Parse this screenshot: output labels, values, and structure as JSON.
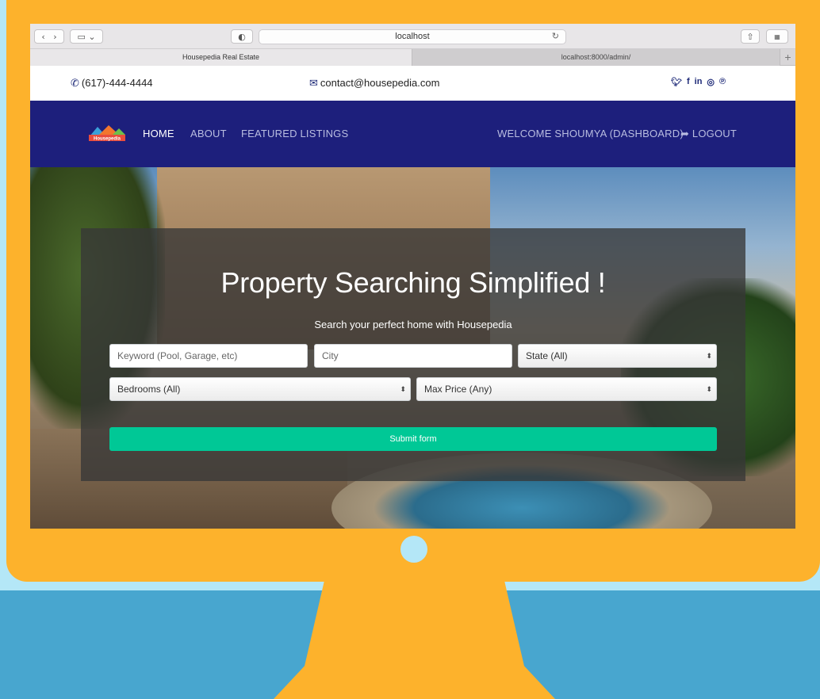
{
  "browser": {
    "url": "localhost",
    "tabs": [
      {
        "label": "Housepedia Real Estate",
        "active": true
      },
      {
        "label": "localhost:8000/admin/",
        "active": false
      }
    ],
    "new_tab_icon": "plus-icon"
  },
  "topbar": {
    "phone": "(617)-444-4444",
    "email": "contact@housepedia.com",
    "social_icons": [
      "twitter-icon",
      "facebook-icon",
      "linkedin-icon",
      "instagram-icon",
      "pinterest-icon"
    ]
  },
  "navbar": {
    "logo_text": "Housepedia",
    "links": [
      "HOME",
      "ABOUT",
      "FEATURED LISTINGS"
    ],
    "active": "HOME",
    "welcome": "WELCOME SHOUMYA (DASHBOARD)",
    "logout": "LOGOUT"
  },
  "hero": {
    "headline": "Property Searching Simplified !",
    "subline": "Search your perfect home with Housepedia"
  },
  "search_form": {
    "keyword_placeholder": "Keyword (Pool, Garage, etc)",
    "city_placeholder": "City",
    "state_selected": "State (All)",
    "bedrooms_selected": "Bedrooms (All)",
    "max_price_selected": "Max Price (Any)",
    "submit_label": "Submit form"
  },
  "colors": {
    "monitor": "#fdb22c",
    "navbar": "#1d1f7c",
    "submit": "#00c896",
    "background": "#48a6cf",
    "sky": "#b4e7f7"
  }
}
